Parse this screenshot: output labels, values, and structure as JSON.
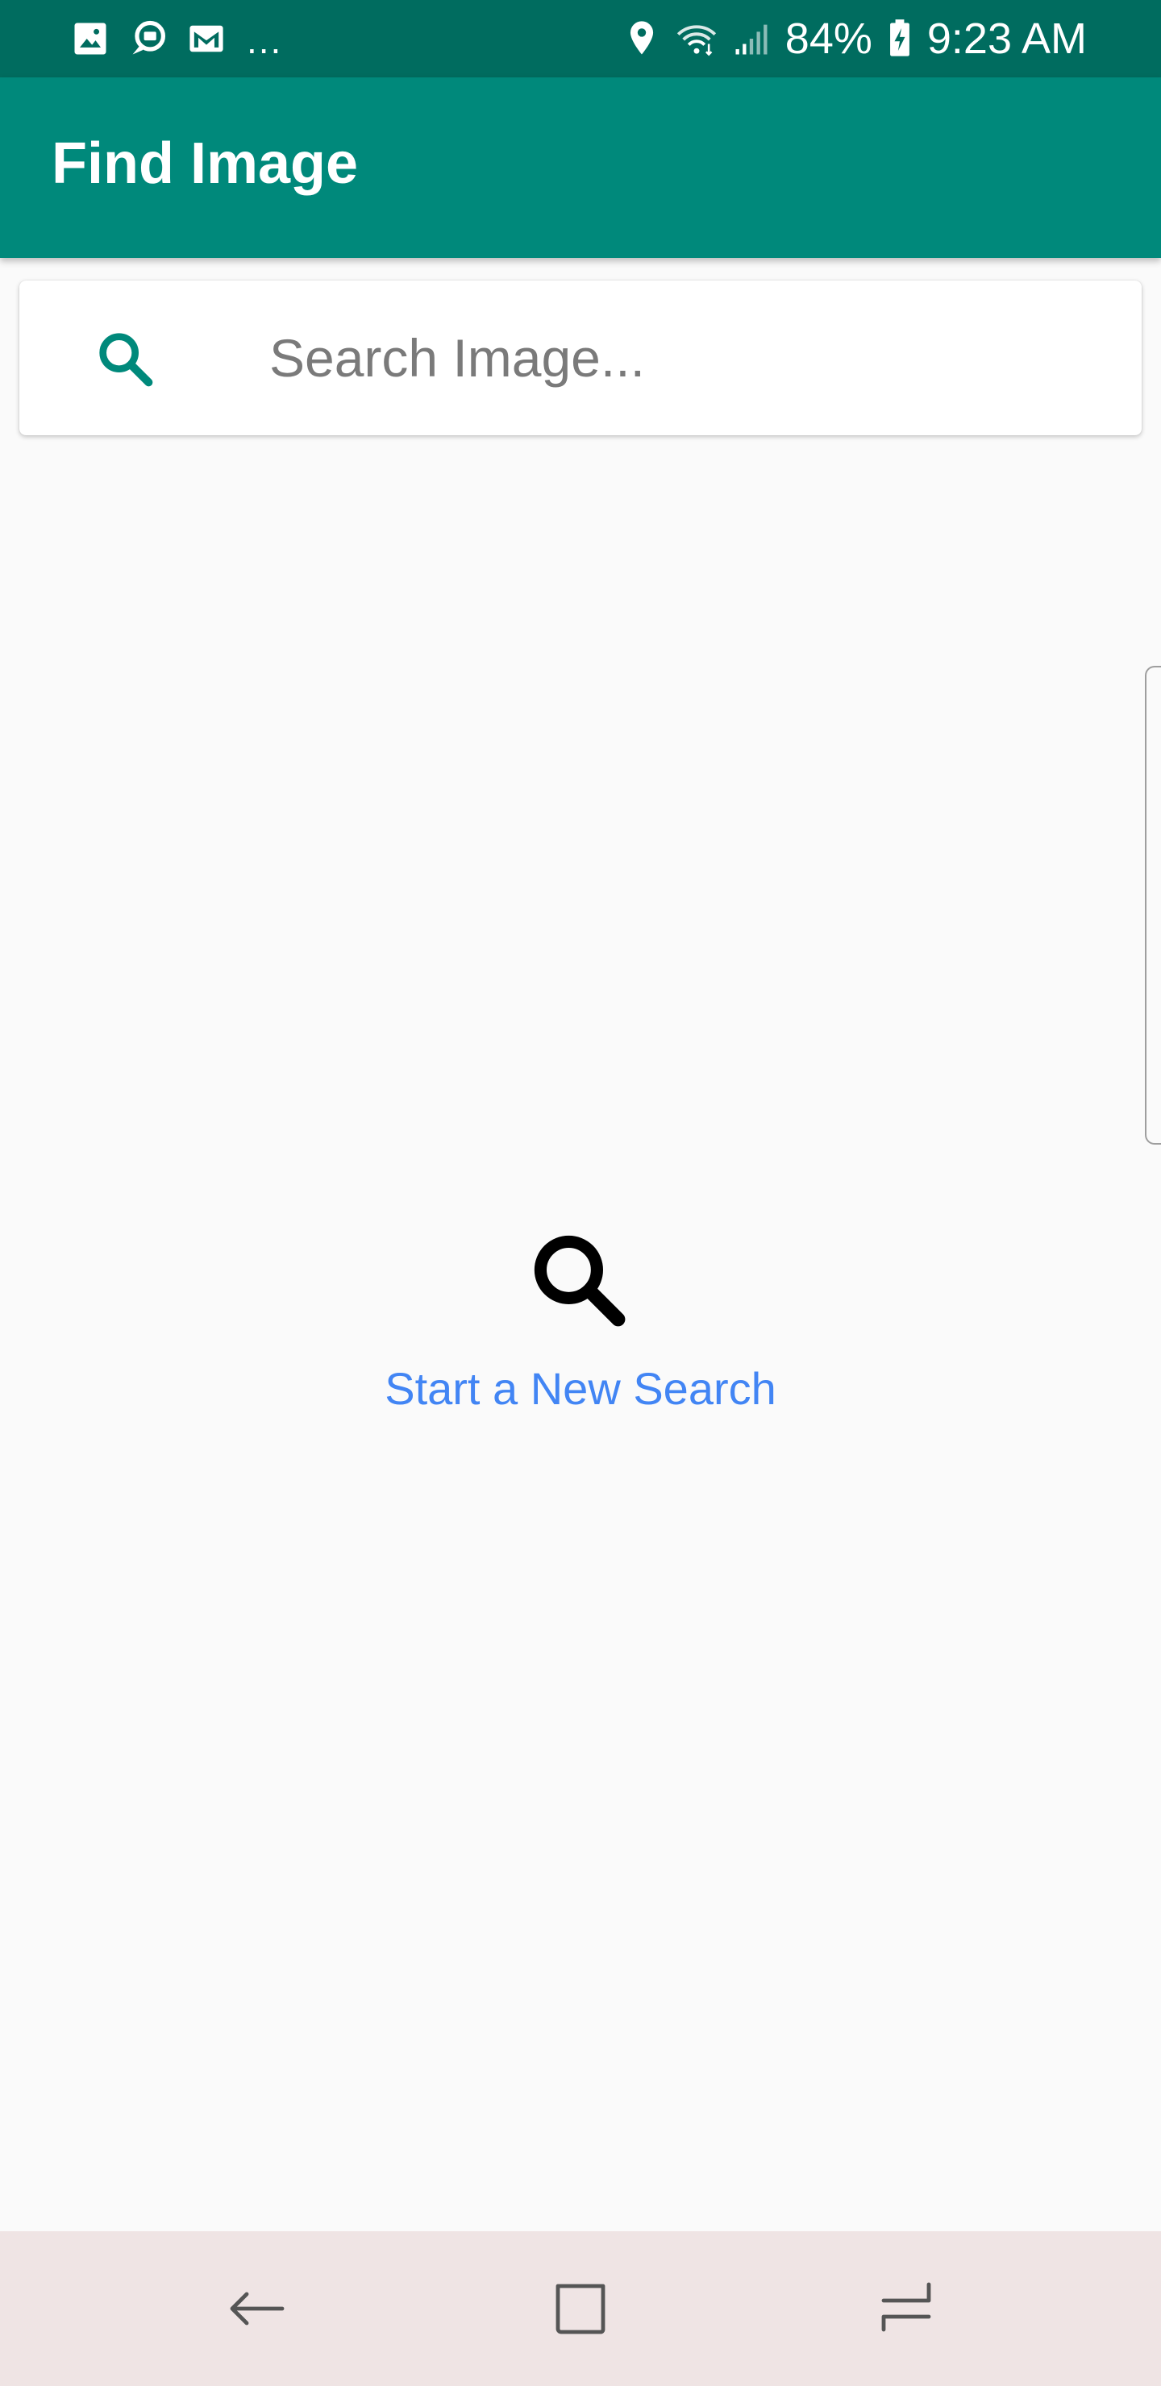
{
  "status_bar": {
    "left_icons": [
      "gallery-icon",
      "chat-bubble-icon",
      "gmail-icon"
    ],
    "overflow": "...",
    "right_icons": [
      "location-pin-icon",
      "wifi-icon",
      "cell-signal-icon",
      "battery-charging-icon"
    ],
    "battery": "84%",
    "time": "9:23 AM"
  },
  "app_bar": {
    "title": "Find Image"
  },
  "search": {
    "icon": "search-icon",
    "placeholder": "Search Image...",
    "value": "",
    "accent_color": "#00897b"
  },
  "empty_state": {
    "icon": "search-icon",
    "message": "Start a New Search",
    "message_color": "#4285f4"
  },
  "nav_bar": {
    "buttons": [
      "back-icon",
      "home-icon",
      "recent-apps-icon"
    ]
  },
  "colors": {
    "status_bar": "#006c5f",
    "app_bar": "#00897b",
    "background": "#fafafa",
    "nav_bar": "#efe4e4"
  }
}
